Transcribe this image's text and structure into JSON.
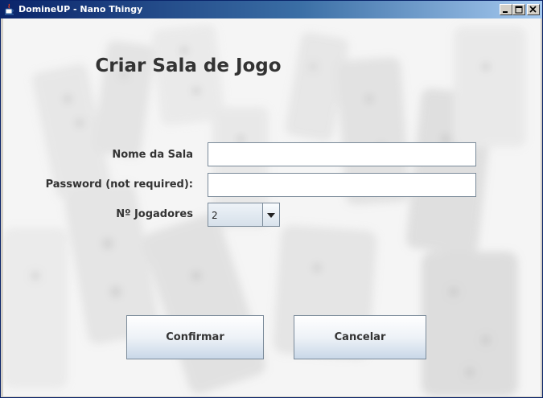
{
  "window": {
    "title": "DomineUP - Nano Thingy"
  },
  "form": {
    "heading": "Criar Sala de Jogo",
    "room_name_label": "Nome da Sala",
    "room_name_value": "",
    "password_label": "Password (not required):",
    "password_value": "",
    "players_label": "Nº Jogadores",
    "players_selected": "2"
  },
  "buttons": {
    "confirm_label": "Confirmar",
    "cancel_label": "Cancelar"
  },
  "icons": {
    "app_icon": "java-cup-icon",
    "minimize": "minimize-icon",
    "maximize": "maximize-icon",
    "close": "close-icon",
    "dropdown": "chevron-down-icon"
  },
  "colors": {
    "titlebar_start": "#0a246a",
    "titlebar_end": "#a6caf0",
    "button_gradient_end": "#c9d8e8",
    "label_text": "#333333"
  }
}
